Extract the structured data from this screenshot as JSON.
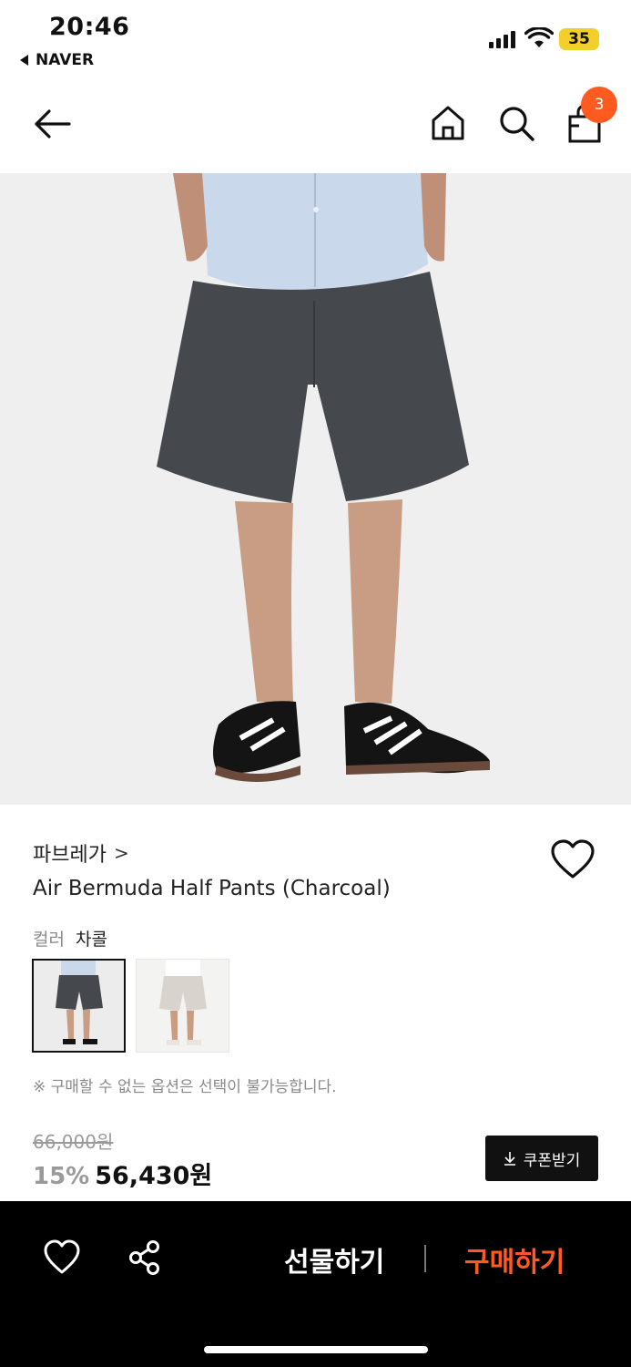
{
  "status_bar": {
    "time": "20:46",
    "back_app": "NAVER",
    "battery": "35"
  },
  "nav": {
    "cart_count": "3",
    "icons": [
      "back-arrow-icon",
      "home-icon",
      "search-icon",
      "shopping-bag-icon"
    ]
  },
  "product": {
    "brand": "파브레가",
    "brand_chevron": ">",
    "title": "Air Bermuda Half Pants (Charcoal)",
    "color_label": "컬러",
    "color_value": "차콜",
    "notice": "※ 구매할 수 없는 옵션은 선택이 불가능합니다.",
    "original_price": "66,000원",
    "discount": "15%",
    "sale_price": "56,430원",
    "coupon_label": "쿠폰받기"
  },
  "bottom_bar": {
    "gift_label": "선물하기",
    "buy_label": "구매하기"
  },
  "colors": {
    "accent": "#ff5a1f",
    "battery": "#f3cf2c",
    "bottom_bar_bg": "#000000"
  }
}
